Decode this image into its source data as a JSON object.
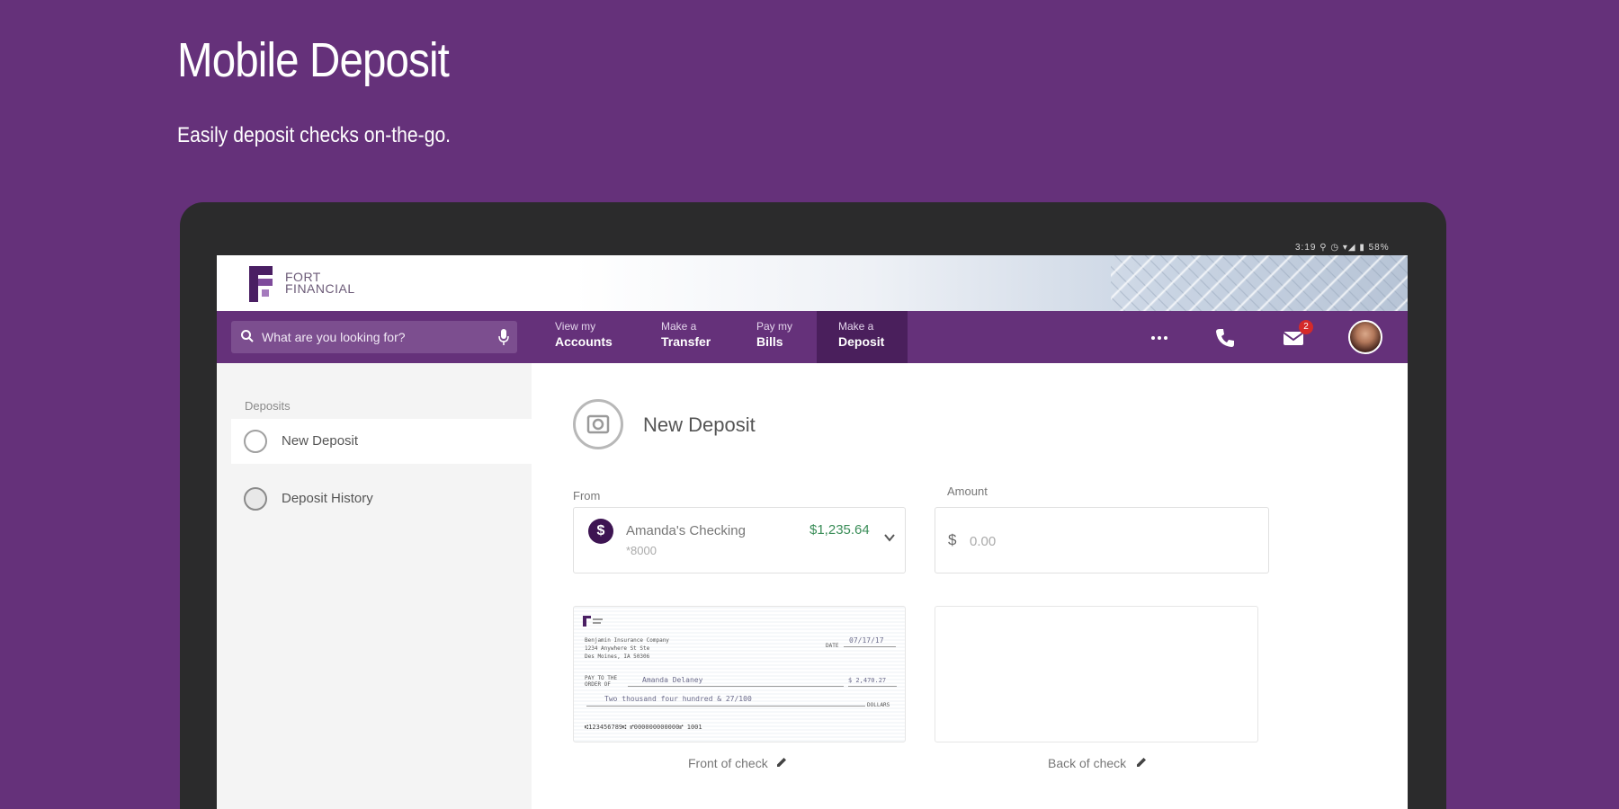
{
  "hero": {
    "title": "Mobile Deposit",
    "subtitle": "Easily deposit checks on-the-go."
  },
  "statusbar": {
    "text": "3:19 ⚲ ◷ ▾◢ ▮ 58%"
  },
  "brand": {
    "name_line1": "FORT",
    "name_line2": "FINANCIAL",
    "accent": "#65317a"
  },
  "search": {
    "placeholder": "What are you looking for?"
  },
  "nav": {
    "items": [
      {
        "line1": "View my",
        "line2": "Accounts"
      },
      {
        "line1": "Make a",
        "line2": "Transfer"
      },
      {
        "line1": "Pay my",
        "line2": "Bills"
      },
      {
        "line1": "Make a",
        "line2": "Deposit"
      }
    ],
    "messages_badge": "2"
  },
  "sidebar": {
    "title": "Deposits",
    "items": [
      {
        "label": "New Deposit"
      },
      {
        "label": "Deposit History"
      }
    ]
  },
  "deposit": {
    "title": "New Deposit",
    "from_label": "From",
    "account_name": "Amanda's Checking",
    "account_number": "*8000",
    "account_balance": "$1,235.64",
    "amount_label": "Amount",
    "currency_symbol": "$",
    "amount_placeholder": "0.00",
    "front_caption": "Front of check",
    "back_caption": "Back of check",
    "check": {
      "issuer_line1": "Benjamin Insurance Company",
      "issuer_line2": "1234 Anywhere St Ste",
      "issuer_line3": "Des Moines, IA 50306",
      "date_label": "DATE",
      "date_value": "07/17/17",
      "payto_label": "PAY TO THE ORDER OF",
      "payee": "Amanda Delaney",
      "amount_value": "$ 2,470.27",
      "amount_words": "Two thousand four hundred & 27/100",
      "dollars_label": "DOLLARS",
      "micr": "⑆123456789⑆ ⑈000000000000⑈ 1001"
    }
  }
}
